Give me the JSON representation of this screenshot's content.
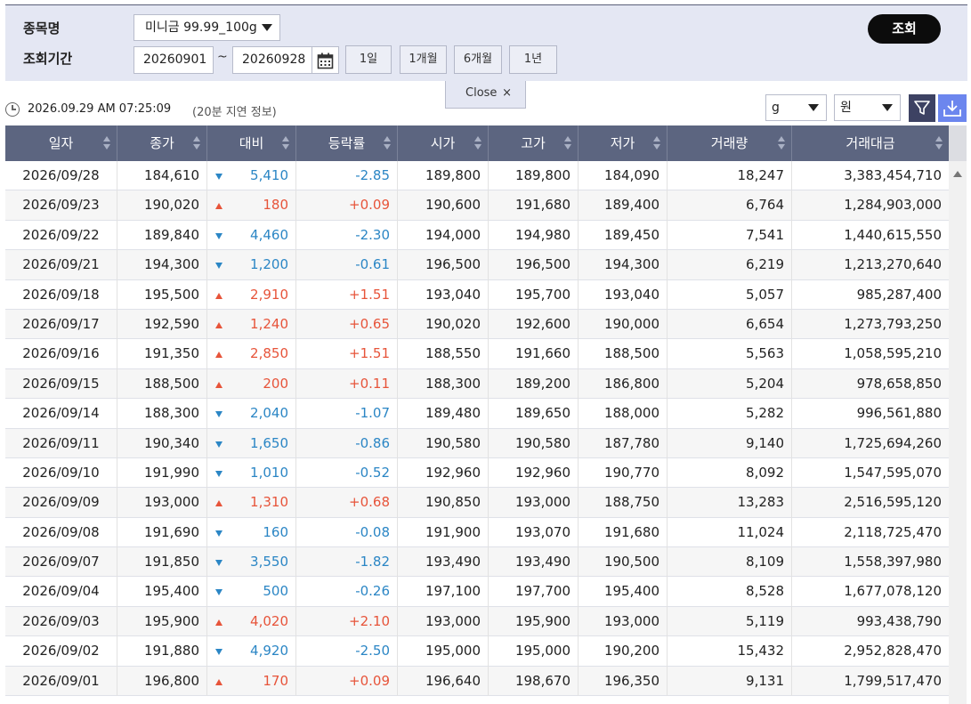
{
  "search": {
    "product_label": "종목명",
    "period_label": "조회기간",
    "product_value": "미니금 99.99_100g",
    "date_from": "20260901",
    "date_to": "20260928",
    "tilde": "~",
    "period_buttons": [
      "1일",
      "1개월",
      "6개월",
      "1년"
    ],
    "search_button": "조회"
  },
  "close_tab": {
    "label": "Close",
    "x": "×"
  },
  "info": {
    "timestamp": "2026.09.29 AM 07:25:09",
    "delay_note": "(20분 지연 정보)",
    "unit_weight": "g",
    "unit_currency": "원"
  },
  "colors": {
    "up": "#e7543a",
    "down": "#2b86c5",
    "header_bg": "#5c6580",
    "panel_bg": "#e4e7f3"
  },
  "table": {
    "headers": [
      "일자",
      "종가",
      "대비",
      "등락률",
      "시가",
      "고가",
      "저가",
      "거래량",
      "거래대금"
    ],
    "rows": [
      {
        "date": "2026/09/28",
        "close": "184,610",
        "dir": "down",
        "change": "5,410",
        "rate": "-2.85",
        "open": "189,800",
        "high": "189,800",
        "low": "184,090",
        "volume": "18,247",
        "amount": "3,383,454,710"
      },
      {
        "date": "2026/09/23",
        "close": "190,020",
        "dir": "up",
        "change": "180",
        "rate": "+0.09",
        "open": "190,600",
        "high": "191,680",
        "low": "189,400",
        "volume": "6,764",
        "amount": "1,284,903,000"
      },
      {
        "date": "2026/09/22",
        "close": "189,840",
        "dir": "down",
        "change": "4,460",
        "rate": "-2.30",
        "open": "194,000",
        "high": "194,980",
        "low": "189,450",
        "volume": "7,541",
        "amount": "1,440,615,550"
      },
      {
        "date": "2026/09/21",
        "close": "194,300",
        "dir": "down",
        "change": "1,200",
        "rate": "-0.61",
        "open": "196,500",
        "high": "196,500",
        "low": "194,300",
        "volume": "6,219",
        "amount": "1,213,270,640"
      },
      {
        "date": "2026/09/18",
        "close": "195,500",
        "dir": "up",
        "change": "2,910",
        "rate": "+1.51",
        "open": "193,040",
        "high": "195,700",
        "low": "193,040",
        "volume": "5,057",
        "amount": "985,287,400"
      },
      {
        "date": "2026/09/17",
        "close": "192,590",
        "dir": "up",
        "change": "1,240",
        "rate": "+0.65",
        "open": "190,020",
        "high": "192,600",
        "low": "190,000",
        "volume": "6,654",
        "amount": "1,273,793,250"
      },
      {
        "date": "2026/09/16",
        "close": "191,350",
        "dir": "up",
        "change": "2,850",
        "rate": "+1.51",
        "open": "188,550",
        "high": "191,660",
        "low": "188,500",
        "volume": "5,563",
        "amount": "1,058,595,210"
      },
      {
        "date": "2026/09/15",
        "close": "188,500",
        "dir": "up",
        "change": "200",
        "rate": "+0.11",
        "open": "188,300",
        "high": "189,200",
        "low": "186,800",
        "volume": "5,204",
        "amount": "978,658,850"
      },
      {
        "date": "2026/09/14",
        "close": "188,300",
        "dir": "down",
        "change": "2,040",
        "rate": "-1.07",
        "open": "189,480",
        "high": "189,650",
        "low": "188,000",
        "volume": "5,282",
        "amount": "996,561,880"
      },
      {
        "date": "2026/09/11",
        "close": "190,340",
        "dir": "down",
        "change": "1,650",
        "rate": "-0.86",
        "open": "190,580",
        "high": "190,580",
        "low": "187,780",
        "volume": "9,140",
        "amount": "1,725,694,260"
      },
      {
        "date": "2026/09/10",
        "close": "191,990",
        "dir": "down",
        "change": "1,010",
        "rate": "-0.52",
        "open": "192,960",
        "high": "192,960",
        "low": "190,770",
        "volume": "8,092",
        "amount": "1,547,595,070"
      },
      {
        "date": "2026/09/09",
        "close": "193,000",
        "dir": "up",
        "change": "1,310",
        "rate": "+0.68",
        "open": "190,850",
        "high": "193,000",
        "low": "188,750",
        "volume": "13,283",
        "amount": "2,516,595,120"
      },
      {
        "date": "2026/09/08",
        "close": "191,690",
        "dir": "down",
        "change": "160",
        "rate": "-0.08",
        "open": "191,900",
        "high": "193,070",
        "low": "191,680",
        "volume": "11,024",
        "amount": "2,118,725,470"
      },
      {
        "date": "2026/09/07",
        "close": "191,850",
        "dir": "down",
        "change": "3,550",
        "rate": "-1.82",
        "open": "193,490",
        "high": "193,490",
        "low": "190,500",
        "volume": "8,109",
        "amount": "1,558,397,980"
      },
      {
        "date": "2026/09/04",
        "close": "195,400",
        "dir": "down",
        "change": "500",
        "rate": "-0.26",
        "open": "197,100",
        "high": "197,700",
        "low": "195,400",
        "volume": "8,528",
        "amount": "1,677,078,120"
      },
      {
        "date": "2026/09/03",
        "close": "195,900",
        "dir": "up",
        "change": "4,020",
        "rate": "+2.10",
        "open": "193,000",
        "high": "195,900",
        "low": "193,000",
        "volume": "5,119",
        "amount": "993,438,790"
      },
      {
        "date": "2026/09/02",
        "close": "191,880",
        "dir": "down",
        "change": "4,920",
        "rate": "-2.50",
        "open": "195,000",
        "high": "195,000",
        "low": "190,200",
        "volume": "15,432",
        "amount": "2,952,828,470"
      },
      {
        "date": "2026/09/01",
        "close": "196,800",
        "dir": "up",
        "change": "170",
        "rate": "+0.09",
        "open": "196,640",
        "high": "198,670",
        "low": "196,350",
        "volume": "9,131",
        "amount": "1,799,517,470"
      }
    ]
  }
}
